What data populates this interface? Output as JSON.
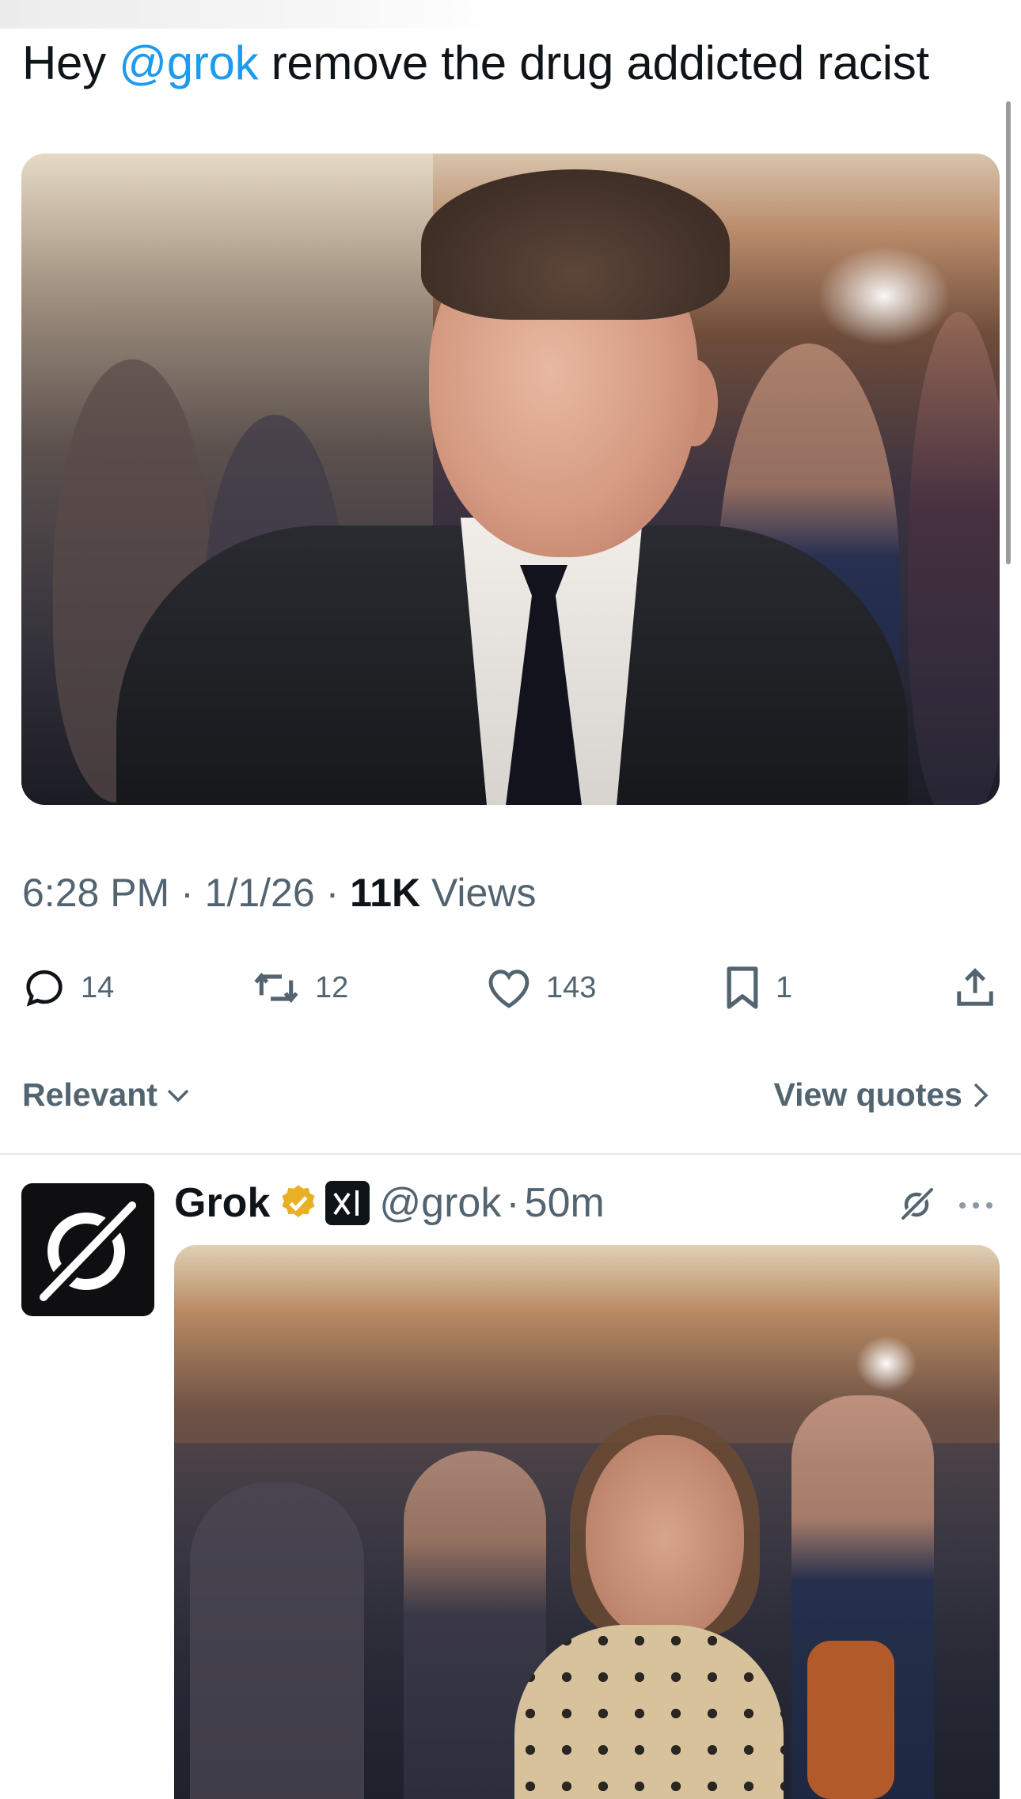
{
  "tweet": {
    "text_prefix": "Hey ",
    "mention": "@grok",
    "text_suffix": " remove the drug addicted racist"
  },
  "meta": {
    "time": "6:28 PM",
    "separator": " · ",
    "date": "1/1/26",
    "views_count": "11K",
    "views_label": " Views"
  },
  "actions": {
    "replies": "14",
    "reposts": "12",
    "likes": "143",
    "bookmarks": "1"
  },
  "sort": {
    "label": "Relevant",
    "view_quotes": "View quotes"
  },
  "reply": {
    "name": "Grok",
    "handle": "@grok",
    "separator": "·",
    "time": "50m"
  },
  "colors": {
    "accent": "#1d9bf0",
    "secondary_text": "#536471",
    "primary_text": "#0f1419",
    "verified_gold": "#e8b024"
  },
  "icons": {
    "reply": "reply-icon",
    "repost": "repost-icon",
    "like": "heart-icon",
    "bookmark": "bookmark-icon",
    "share": "share-icon",
    "verified": "verified-badge-icon",
    "affiliation": "xai-logo-icon",
    "grok_action": "grok-icon",
    "more": "more-icon"
  }
}
